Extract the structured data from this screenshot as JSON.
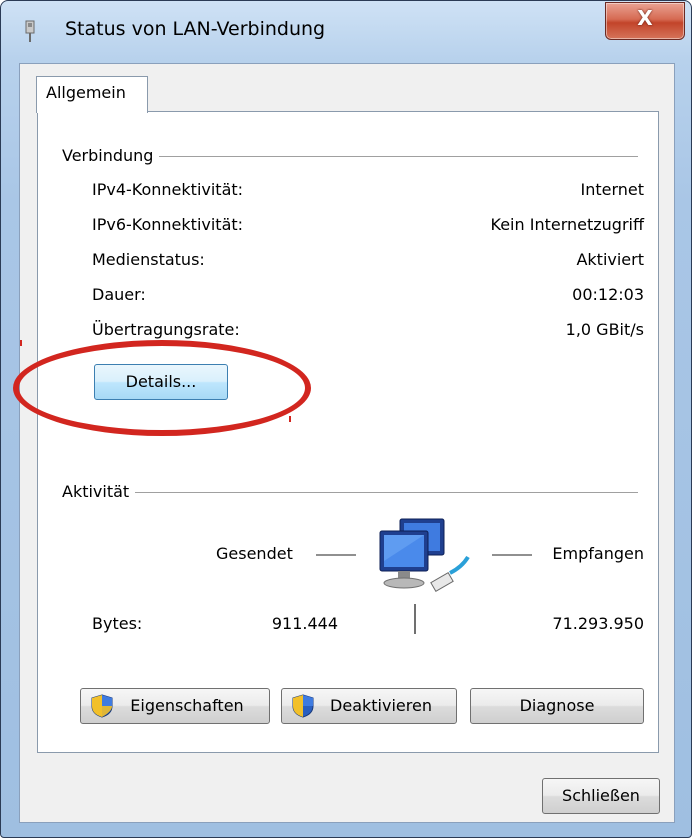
{
  "window": {
    "title": "Status von LAN-Verbindung",
    "close_label": "X"
  },
  "tabs": [
    {
      "label": "Allgemein",
      "selected": true
    }
  ],
  "connection": {
    "group_label": "Verbindung",
    "rows": [
      {
        "label": "IPv4-Konnektivität:",
        "value": "Internet"
      },
      {
        "label": "IPv6-Konnektivität:",
        "value": "Kein Internetzugriff"
      },
      {
        "label": "Medienstatus:",
        "value": "Aktiviert"
      },
      {
        "label": "Dauer:",
        "value": "00:12:03"
      },
      {
        "label": "Übertragungsrate:",
        "value": "1,0 GBit/s"
      }
    ],
    "details_button": "Details..."
  },
  "activity": {
    "group_label": "Aktivität",
    "sent_label": "Gesendet",
    "received_label": "Empfangen",
    "bytes_label": "Bytes:",
    "bytes_sent": "911.444",
    "bytes_received": "71.293.950",
    "icon": "network-computers-icon"
  },
  "buttons": {
    "properties": "Eigenschaften",
    "disable": "Deaktivieren",
    "diagnose": "Diagnose",
    "close": "Schließen"
  },
  "colors": {
    "highlight_oval": "#d2261f",
    "focus_button": "#3c7fb1"
  }
}
